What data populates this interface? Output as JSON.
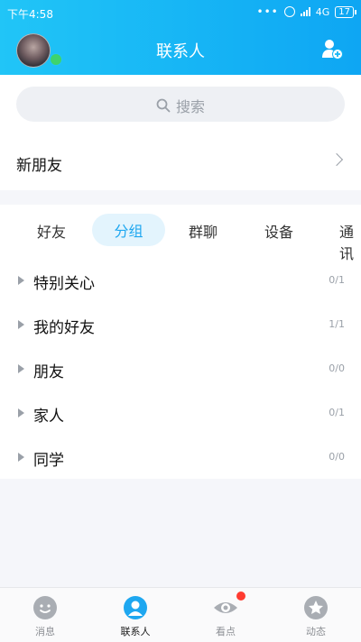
{
  "status_bar": {
    "time": "下午4:58",
    "network": "4G",
    "battery": "17"
  },
  "header": {
    "title": "联系人"
  },
  "search": {
    "placeholder": "搜索"
  },
  "new_friends": {
    "label": "新朋友"
  },
  "tabs": [
    {
      "label": "好友"
    },
    {
      "label": "分组",
      "active": true
    },
    {
      "label": "群聊"
    },
    {
      "label": "设备"
    },
    {
      "label": "通讯"
    }
  ],
  "groups": [
    {
      "name": "特别关心",
      "count": "0/1"
    },
    {
      "name": "我的好友",
      "count": "1/1"
    },
    {
      "name": "朋友",
      "count": "0/0"
    },
    {
      "name": "家人",
      "count": "0/1"
    },
    {
      "name": "同学",
      "count": "0/0"
    }
  ],
  "bottom_nav": [
    {
      "label": "消息",
      "icon": "message-icon"
    },
    {
      "label": "联系人",
      "icon": "contacts-icon",
      "active": true
    },
    {
      "label": "看点",
      "icon": "watch-icon",
      "badge": true
    },
    {
      "label": "动态",
      "icon": "feed-icon"
    }
  ],
  "colors": {
    "accent": "#1ea7f0",
    "header_gradient_start": "#21c5f7",
    "header_gradient_end": "#0ea6f3"
  }
}
